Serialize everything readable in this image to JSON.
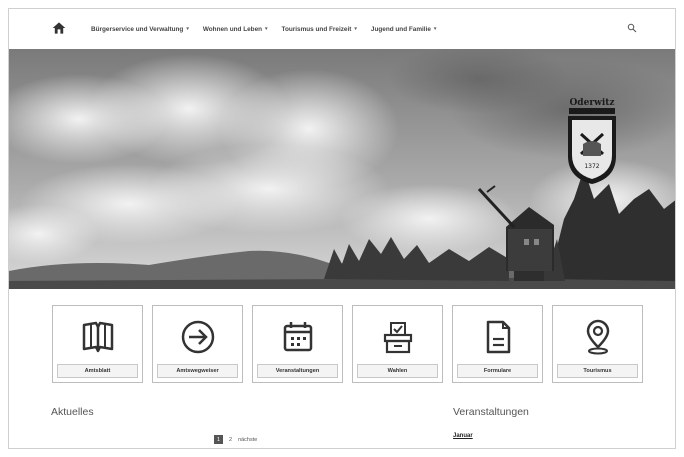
{
  "nav": {
    "items": [
      {
        "label": "Bürgerservice und Verwaltung"
      },
      {
        "label": "Wohnen und Leben"
      },
      {
        "label": "Tourismus und Freizeit"
      },
      {
        "label": "Jugend und Familie"
      }
    ],
    "caret": "▾"
  },
  "hero": {
    "crest_text": "Oderwitz",
    "crest_year": "1372"
  },
  "tiles": [
    {
      "label": "Amtsblatt",
      "icon": "book-icon"
    },
    {
      "label": "Amtswegweiser",
      "icon": "arrow-right-circle-icon"
    },
    {
      "label": "Veranstaltungen",
      "icon": "calendar-icon"
    },
    {
      "label": "Wahlen",
      "icon": "ballot-box-icon"
    },
    {
      "label": "Formulare",
      "icon": "document-icon"
    },
    {
      "label": "Tourismus",
      "icon": "map-pin-icon"
    }
  ],
  "news": {
    "title": "Aktuelles",
    "pages": [
      "1",
      "2"
    ],
    "next": "nächste"
  },
  "events": {
    "title": "Veranstaltungen",
    "month": "Januar"
  }
}
